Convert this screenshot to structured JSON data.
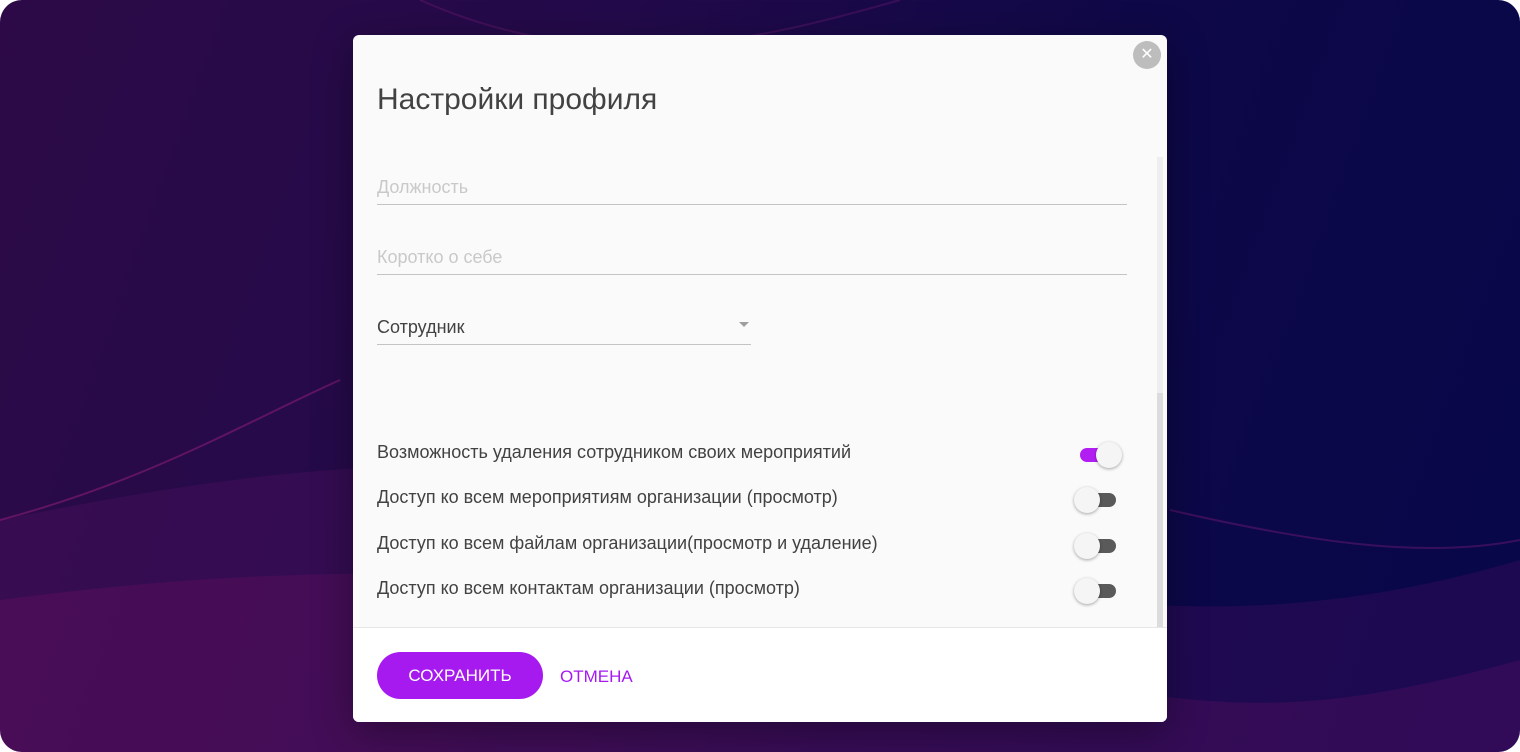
{
  "modal": {
    "title": "Настройки профиля",
    "close_icon": "close-icon"
  },
  "fields": {
    "position": {
      "placeholder": "Должность",
      "value": ""
    },
    "about": {
      "placeholder": "Коротко о себе",
      "value": ""
    }
  },
  "role_select": {
    "selected": "Сотрудник"
  },
  "toggles": [
    {
      "label": "Возможность удаления сотрудником своих мероприятий",
      "on": true
    },
    {
      "label": "Доступ ко всем мероприятиям организации (просмотр)",
      "on": false
    },
    {
      "label": "Доступ ко всем файлам организации(просмотр и удаление)",
      "on": false
    },
    {
      "label": "Доступ ко всем контактам организации (просмотр)",
      "on": false
    }
  ],
  "footer": {
    "save_label": "СОХРАНИТЬ",
    "cancel_label": "ОТМЕНА"
  },
  "colors": {
    "accent": "#a61af0",
    "toggle_off": "#5a5a5a"
  }
}
